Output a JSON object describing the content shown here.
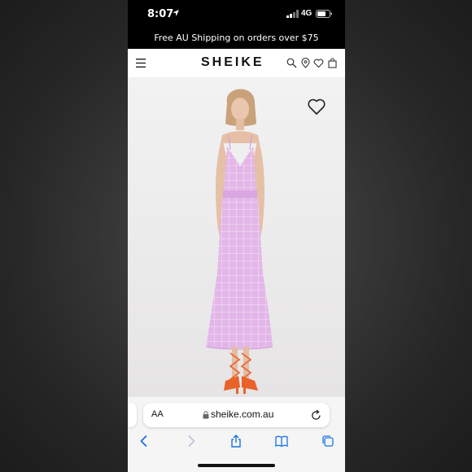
{
  "status_bar": {
    "time": "8:07",
    "network": "4G"
  },
  "promo": {
    "text": "Free AU Shipping on orders over $75"
  },
  "header": {
    "logo": "SHEIKE"
  },
  "browser": {
    "text_size_label": "AA",
    "url": "sheike.com.au"
  },
  "colors": {
    "dress": "#e3b6e8",
    "sandals": "#e8622a",
    "background": "#ebeaeb"
  }
}
